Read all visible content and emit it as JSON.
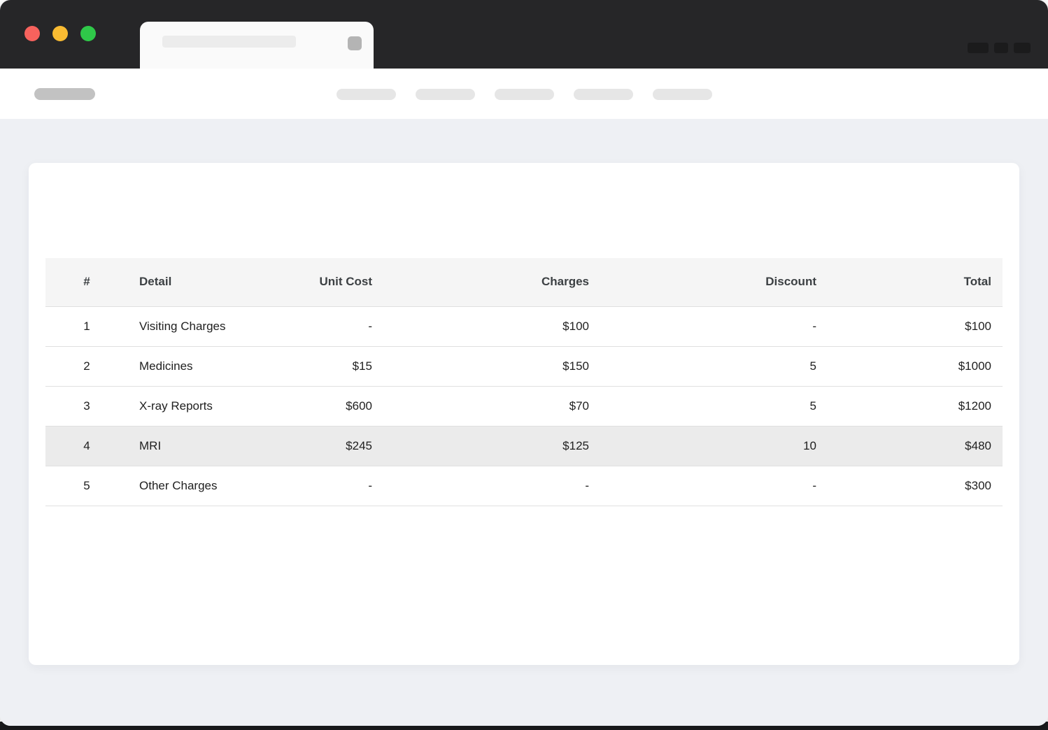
{
  "window": {
    "titlebar": {
      "traffic_lights": [
        {
          "name": "close",
          "color": "#f7625d"
        },
        {
          "name": "minimize",
          "color": "#f9bb32"
        },
        {
          "name": "maximize",
          "color": "#2fc849"
        }
      ]
    }
  },
  "colors": {
    "titlebar_bg": "#262628",
    "tab_bg": "#fafafa",
    "toolbar_bg": "#ffffff",
    "page_bg": "#eef0f4",
    "card_bg": "#ffffff",
    "header_bg": "#f5f5f5",
    "highlight_row_bg": "#ebebeb",
    "row_border": "#e0e0e0",
    "header_text": "#3c4043",
    "cell_text": "#212121"
  },
  "invoice_table": {
    "columns": [
      {
        "key": "index",
        "label": "#",
        "align": "center"
      },
      {
        "key": "detail",
        "label": "Detail",
        "align": "left"
      },
      {
        "key": "unit_cost",
        "label": "Unit Cost",
        "align": "right"
      },
      {
        "key": "charges",
        "label": "Charges",
        "align": "right"
      },
      {
        "key": "discount",
        "label": "Discount",
        "align": "right"
      },
      {
        "key": "total",
        "label": "Total",
        "align": "right"
      }
    ],
    "rows": [
      {
        "cells": [
          "1",
          "Visiting Charges",
          "-",
          "$100",
          "-",
          "$100"
        ],
        "highlighted": false
      },
      {
        "cells": [
          "2",
          "Medicines",
          "$15",
          "$150",
          "5",
          "$1000"
        ],
        "highlighted": false
      },
      {
        "cells": [
          "3",
          "X-ray Reports",
          "$600",
          "$70",
          "5",
          "$1200"
        ],
        "highlighted": false
      },
      {
        "cells": [
          "4",
          "MRI",
          "$245",
          "$125",
          "10",
          "$480"
        ],
        "highlighted": true
      },
      {
        "cells": [
          "5",
          "Other Charges",
          "-",
          "-",
          "-",
          "$300"
        ],
        "highlighted": false
      }
    ]
  }
}
